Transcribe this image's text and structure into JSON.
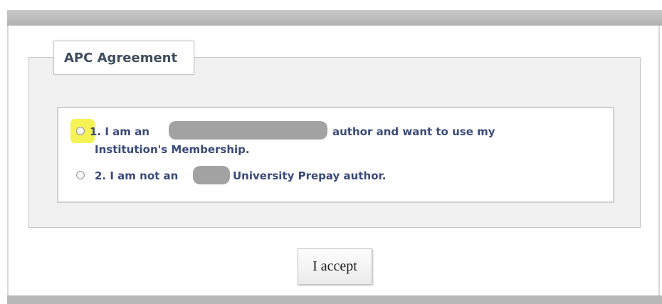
{
  "agreement": {
    "legend": "APC Agreement",
    "options": [
      {
        "line1_prefix": "1. I am an",
        "line1_suffix": "author and want to use my",
        "line2": "Institution's Membership."
      },
      {
        "prefix": "2. I am not an",
        "suffix": "University Prepay author."
      }
    ]
  },
  "actions": {
    "accept_label": "I accept"
  },
  "colors": {
    "highlight": "#f4f14b",
    "option_text": "#3a4a7a",
    "redaction": "#a2a2a2"
  }
}
